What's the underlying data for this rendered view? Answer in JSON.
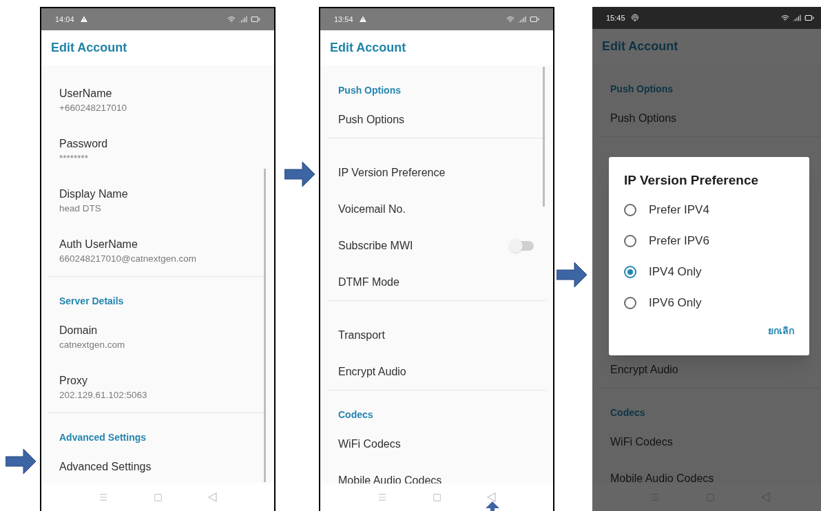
{
  "screens": [
    {
      "status_bar": {
        "time": "14:04",
        "alert": true,
        "dark": false
      },
      "title": "Edit Account",
      "pointer_arrow": true,
      "scrollbar": true,
      "items": [
        {
          "kind": "setting",
          "label": "UserName",
          "value": "+660248217010"
        },
        {
          "kind": "setting",
          "label": "Password",
          "value": "********"
        },
        {
          "kind": "setting",
          "label": "Display Name",
          "value": "head DTS"
        },
        {
          "kind": "setting",
          "label": "Auth UserName",
          "value": "660248217010@catnextgen.com"
        },
        {
          "kind": "divider"
        },
        {
          "kind": "header",
          "label": "Server Details"
        },
        {
          "kind": "setting",
          "label": "Domain",
          "value": "catnextgen.com"
        },
        {
          "kind": "setting",
          "label": "Proxy",
          "value": "202.129.61.102:5063"
        },
        {
          "kind": "divider"
        },
        {
          "kind": "header",
          "label": "Advanced Settings"
        },
        {
          "kind": "setting",
          "label": "Advanced Settings"
        }
      ]
    },
    {
      "status_bar": {
        "time": "13:54",
        "alert": true,
        "dark": false
      },
      "title": "Edit Account",
      "pointer_arrow": true,
      "back_arrow": true,
      "scrollbar": true,
      "items": [
        {
          "kind": "header",
          "label": "Push Options"
        },
        {
          "kind": "setting",
          "label": "Push Options"
        },
        {
          "kind": "divider"
        },
        {
          "kind": "setting",
          "label": "IP Version Preference"
        },
        {
          "kind": "setting",
          "label": "Voicemail No."
        },
        {
          "kind": "switch",
          "label": "Subscribe MWI",
          "on": false
        },
        {
          "kind": "setting",
          "label": "DTMF Mode"
        },
        {
          "kind": "divider"
        },
        {
          "kind": "setting",
          "label": "Transport"
        },
        {
          "kind": "setting",
          "label": "Encrypt Audio"
        },
        {
          "kind": "divider"
        },
        {
          "kind": "header",
          "label": "Codecs"
        },
        {
          "kind": "setting",
          "label": "WiFi Codecs"
        },
        {
          "kind": "setting",
          "label": "Mobile Audio Codecs"
        }
      ]
    },
    {
      "status_bar": {
        "time": "15:45",
        "alert": false,
        "dark": true
      },
      "title": "Edit Account",
      "pointer_arrow": true,
      "items": [
        {
          "kind": "header",
          "label": "Push Options"
        },
        {
          "kind": "setting",
          "label": "Push Options"
        },
        {
          "kind": "divider"
        },
        {
          "kind": "covered"
        },
        {
          "kind": "setting",
          "label": "Encrypt Audio"
        },
        {
          "kind": "divider"
        },
        {
          "kind": "header",
          "label": "Codecs"
        },
        {
          "kind": "setting",
          "label": "WiFi Codecs"
        },
        {
          "kind": "setting",
          "label": "Mobile Audio Codecs"
        }
      ],
      "dialog": {
        "title": "IP Version Preference",
        "options": [
          {
            "label": "Prefer IPV4",
            "selected": false
          },
          {
            "label": "Prefer IPV6",
            "selected": false
          },
          {
            "label": "IPV4 Only",
            "selected": true
          },
          {
            "label": "IPV6 Only",
            "selected": false
          }
        ],
        "cancel": "ยกเลิก"
      }
    }
  ]
}
